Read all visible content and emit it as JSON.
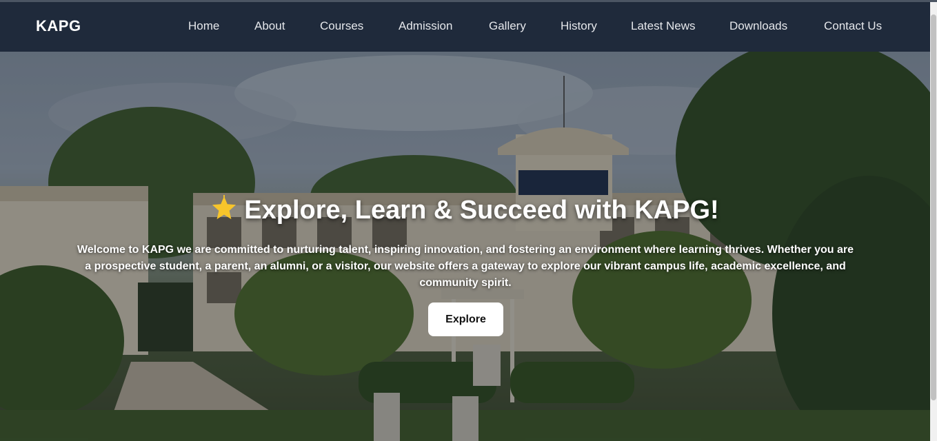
{
  "navbar": {
    "brand": "KAPG",
    "links": [
      {
        "label": "Home"
      },
      {
        "label": "About"
      },
      {
        "label": "Courses"
      },
      {
        "label": "Admission"
      },
      {
        "label": "Gallery"
      },
      {
        "label": "History"
      },
      {
        "label": "Latest News"
      },
      {
        "label": "Downloads"
      },
      {
        "label": "Contact Us"
      }
    ]
  },
  "hero": {
    "title": "Explore, Learn & Succeed with KAPG!",
    "title_icon": "star-icon",
    "text": "Welcome to KAPG we are committed to nurturing talent, inspiring innovation, and fostering an environment where learning thrives. Whether you are a prospective student, a parent, an alumni, or a visitor, our website offers a gateway to explore our vibrant campus life, academic excellence, and community spirit.",
    "button_label": "Explore"
  },
  "colors": {
    "navbar_bg": "#1f2a3b",
    "nav_text": "#e5e7eb",
    "button_bg": "#ffffff",
    "hero_text": "#ffffff"
  }
}
